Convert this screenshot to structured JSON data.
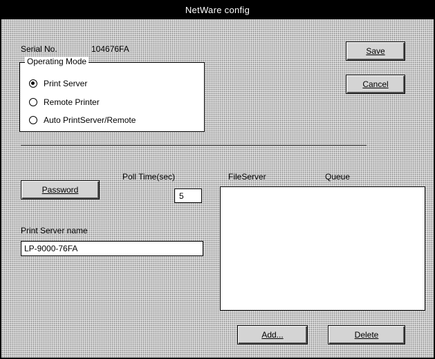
{
  "window": {
    "title": "NetWare config"
  },
  "serial": {
    "label": "Serial No.",
    "value": "104676FA"
  },
  "operating_mode": {
    "legend": "Operating Mode",
    "options": [
      {
        "label": "Print Server",
        "checked": true
      },
      {
        "label": "Remote Printer",
        "checked": false
      },
      {
        "label": "Auto PrintServer/Remote",
        "checked": false
      }
    ]
  },
  "buttons": {
    "save": "Save",
    "cancel": "Cancel",
    "password": "Password",
    "add": "Add...",
    "delete": "Delete"
  },
  "poll_time": {
    "label": "Poll Time(sec)",
    "value": "5"
  },
  "list": {
    "fileserver_header": "FileServer",
    "queue_header": "Queue"
  },
  "print_server_name": {
    "label": "Print Server name",
    "value": "LP-9000-76FA"
  }
}
